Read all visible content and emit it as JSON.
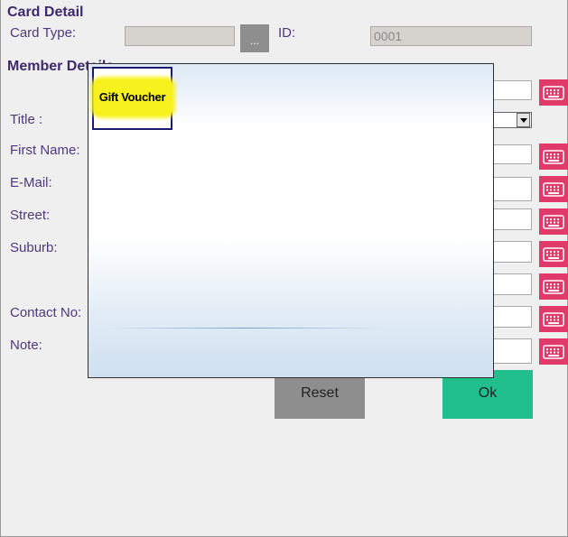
{
  "card_detail": {
    "title": "Card Detail",
    "card_type_label": "Card Type:",
    "card_type_value": "",
    "browse_label": "...",
    "id_label": "ID:",
    "id_value": "0001"
  },
  "member_detail": {
    "title": "Member Details",
    "title_label": "Title :",
    "first_name_label": "First Name:",
    "email_label": "E-Mail:",
    "street_label": "Street:",
    "suburb_label": "Suburb:",
    "contact_label": "Contact No:",
    "note_label": "Note:"
  },
  "buttons": {
    "reset": "Reset",
    "ok": "Ok"
  },
  "popup": {
    "items": [
      {
        "label": "Gift Voucher",
        "highlight_color": "#f7f21d"
      }
    ]
  },
  "icons": {
    "keyboard": "keyboard-icon",
    "dropdown": "chevron-down-icon"
  },
  "colors": {
    "keyboard_button": "#e1396a",
    "ok_button": "#20bf8c",
    "reset_button": "#8e8e8e",
    "label_text": "#4b3a7a"
  }
}
